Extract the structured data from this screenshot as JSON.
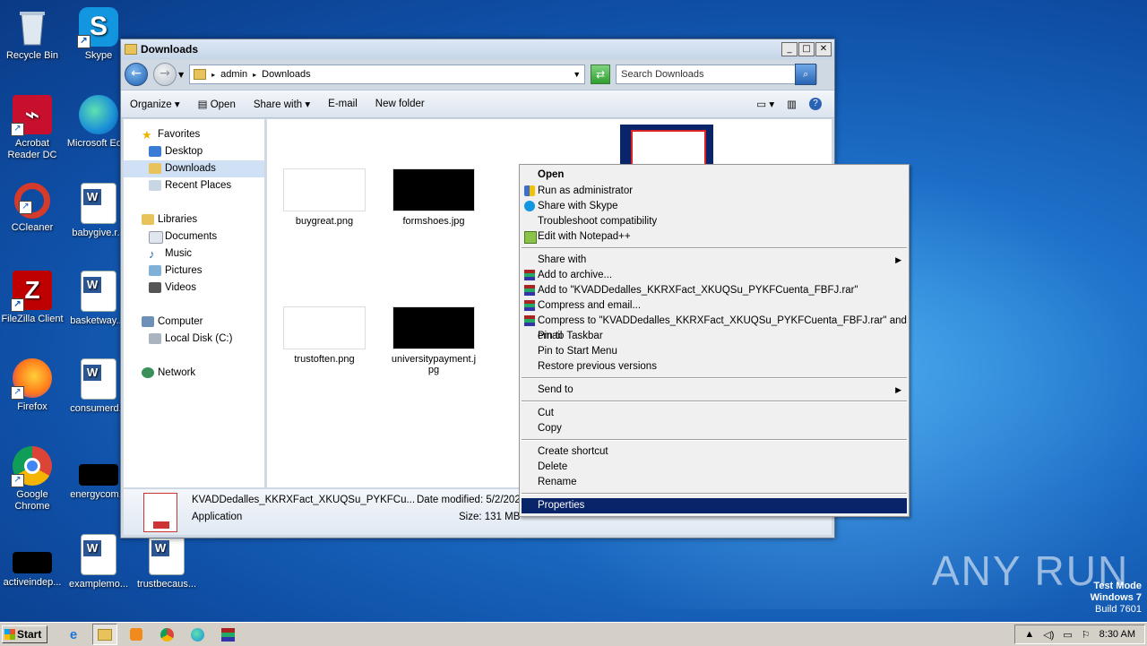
{
  "desktop": {
    "icons": [
      {
        "label": "Recycle Bin"
      },
      {
        "label": "Skype"
      },
      {
        "label": "Acrobat Reader DC"
      },
      {
        "label": "Microsoft Ed..."
      },
      {
        "label": "CCleaner"
      },
      {
        "label": "babygive.r..."
      },
      {
        "label": "FileZilla Client"
      },
      {
        "label": "basketway...."
      },
      {
        "label": "Firefox"
      },
      {
        "label": "consumerd..."
      },
      {
        "label": "Google Chrome"
      },
      {
        "label": "energycom..."
      },
      {
        "label": "activeindep..."
      },
      {
        "label": "examplemo..."
      },
      {
        "label": "trustbecaus..."
      }
    ]
  },
  "explorer": {
    "title": "Downloads",
    "address": {
      "part1": "admin",
      "part2": "Downloads"
    },
    "search_placeholder": "Search Downloads",
    "toolbar": {
      "organize": "Organize",
      "open": "Open",
      "share_with": "Share with",
      "email": "E-mail",
      "new_folder": "New folder"
    },
    "nav": {
      "favorites": "Favorites",
      "desktop": "Desktop",
      "downloads": "Downloads",
      "recent": "Recent Places",
      "libraries": "Libraries",
      "documents": "Documents",
      "music": "Music",
      "pictures": "Pictures",
      "videos": "Videos",
      "computer": "Computer",
      "local_disk": "Local Disk (C:)",
      "network": "Network"
    },
    "files": [
      {
        "name": "buygreat.png"
      },
      {
        "name": "formshoes.jpg"
      },
      {
        "name": "trustoften.png"
      },
      {
        "name": "universitypayment.jpg"
      }
    ],
    "selected_file_partial": [
      "KV",
      "XF",
      "KF"
    ],
    "details": {
      "filename": "KVADDedalles_KKRXFact_XKUQSu_PYKFCu...",
      "type": "Application",
      "date_modified": "Date modified: 5/2/202",
      "size": "Size: 131 MB"
    }
  },
  "context_menu": {
    "items": [
      {
        "label": "Open",
        "bold": true
      },
      {
        "label": "Run as administrator"
      },
      {
        "label": "Share with Skype"
      },
      {
        "label": "Troubleshoot compatibility"
      },
      {
        "label": "Edit with Notepad++"
      },
      {
        "label": "Share with"
      },
      {
        "label": "Add to archive..."
      },
      {
        "label": "Add to \"KVADDedalles_KKRXFact_XKUQSu_PYKFCuenta_FBFJ.rar\""
      },
      {
        "label": "Compress and email..."
      },
      {
        "label": "Compress to \"KVADDedalles_KKRXFact_XKUQSu_PYKFCuenta_FBFJ.rar\" and email"
      },
      {
        "label": "Pin to Taskbar"
      },
      {
        "label": "Pin to Start Menu"
      },
      {
        "label": "Restore previous versions"
      },
      {
        "label": "Send to"
      },
      {
        "label": "Cut"
      },
      {
        "label": "Copy"
      },
      {
        "label": "Create shortcut"
      },
      {
        "label": "Delete"
      },
      {
        "label": "Rename"
      },
      {
        "label": "Properties"
      }
    ]
  },
  "taskbar": {
    "start": "Start",
    "time": "8:30 AM"
  },
  "watermark": {
    "line1": "Test Mode",
    "line2": "Windows 7",
    "line3": "Build 7601"
  },
  "brand": {
    "text": "ANY RUN"
  }
}
